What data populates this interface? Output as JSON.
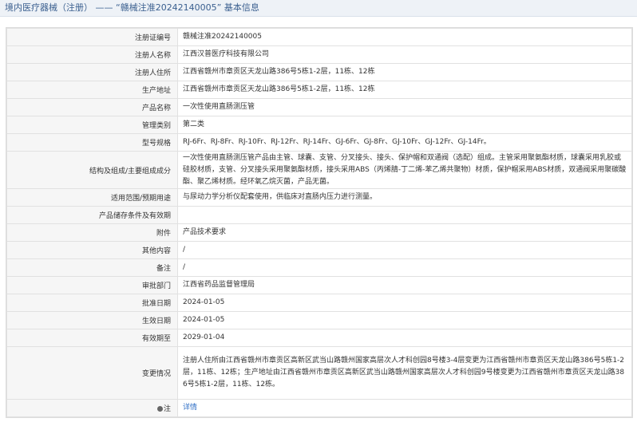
{
  "header": {
    "title": "境内医疗器械（注册） —— “赣械注准20242140005” 基本信息"
  },
  "rows": [
    {
      "label": "注册证编号",
      "value": "赣械注准20242140005"
    },
    {
      "label": "注册人名称",
      "value": "江西汉普医疗科技有限公司"
    },
    {
      "label": "注册人住所",
      "value": "江西省赣州市章贡区天龙山路386号5栋1-2层，11栋、12栋"
    },
    {
      "label": "生产地址",
      "value": "江西省赣州市章贡区天龙山路386号5栋1-2层，11栋、12栋"
    },
    {
      "label": "产品名称",
      "value": "一次性使用直肠测压管"
    },
    {
      "label": "管理类别",
      "value": "第二类"
    },
    {
      "label": "型号规格",
      "value": "RJ-6Fr、RJ-8Fr、RJ-10Fr、RJ-12Fr、RJ-14Fr、GJ-6Fr、GJ-8Fr、GJ-10Fr、GJ-12Fr、GJ-14Fr。"
    },
    {
      "label": "结构及组成/主要组成成分",
      "value": "一次性使用直肠测压管产品由主管、球囊、支管、分叉接头、接头、保护帽和双通阀（选配）组成。主管采用聚氨酯材质，球囊采用乳胶或硅胶材质，支管、分叉接头采用聚氨酯材质，接头采用ABS（丙烯腈-丁二烯-苯乙烯共聚物）材质，保护帽采用ABS材质，双通阀采用聚碳酸酯、聚乙烯材质。经环氧乙烷灭菌，产品无菌。"
    },
    {
      "label": "适用范围/预期用途",
      "value": "与尿动力学分析仪配套使用，供临床对直肠内压力进行测量。"
    },
    {
      "label": "产品储存条件及有效期",
      "value": ""
    },
    {
      "label": "附件",
      "value": "产品技术要求"
    },
    {
      "label": "其他内容",
      "value": "/"
    },
    {
      "label": "备注",
      "value": "/"
    },
    {
      "label": "审批部门",
      "value": "江西省药品监督管理局"
    },
    {
      "label": "批准日期",
      "value": "2024-01-05"
    },
    {
      "label": "生效日期",
      "value": "2024-01-05"
    },
    {
      "label": "有效期至",
      "value": "2029-01-04"
    },
    {
      "label": "变更情况",
      "value": "注册人住所由江西省赣州市章贡区高新区武当山路赣州国家高层次人才科创园8号楼3-4层变更为江西省赣州市章贡区天龙山路386号5栋1-2层，11栋、12栋；生产地址由江西省赣州市章贡区高新区武当山路赣州国家高层次人才科创园9号楼变更为江西省赣州市章贡区天龙山路386号5栋1-2层，11栋、12栋。"
    }
  ],
  "note": {
    "label": "注",
    "link_text": "详情"
  }
}
